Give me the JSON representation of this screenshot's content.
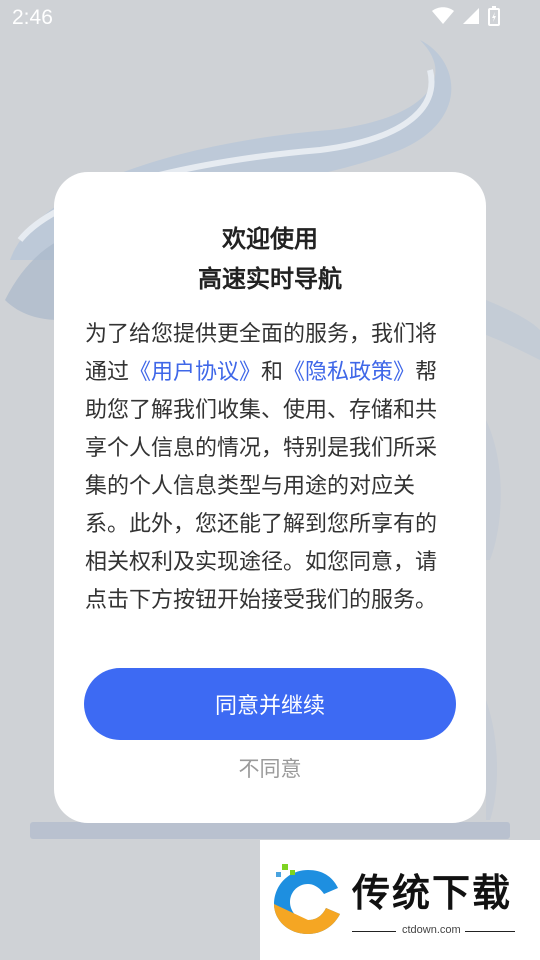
{
  "status_bar": {
    "time": "2:46",
    "icons": [
      "wifi-icon",
      "signal-icon",
      "battery-charging-icon"
    ]
  },
  "dialog": {
    "title_line1": "欢迎使用",
    "title_line2": "高速实时导航",
    "body": {
      "part1": "为了给您提供更全面的服务，我们将通过",
      "link_user_agreement": "《用户协议》",
      "conj": "和",
      "link_privacy_policy": "《隐私政策》",
      "part2": "帮助您了解我们收集、使用、存储和共享个人信息的情况，特别是我们所采集的个人信息类型与用途的对应关系。此外，您还能了解到您所享有的相关权利及实现途径。如您同意，请点击下方按钮开始接受我们的服务。"
    },
    "agree_label": "同意并继续",
    "disagree_label": "不同意"
  },
  "watermark": {
    "brand": "传统下载",
    "url": "ctdown.com"
  },
  "colors": {
    "accent": "#3d6af3",
    "link": "#3f67e8",
    "background": "#cfd2d6"
  }
}
